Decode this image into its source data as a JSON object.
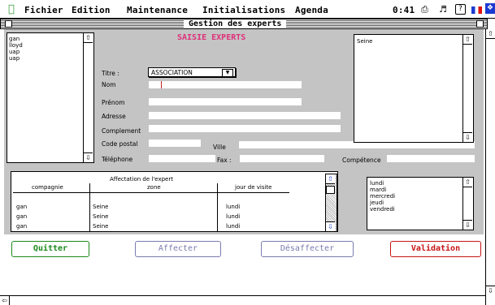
{
  "menubar": {
    "items": [
      "Fichier",
      "Edition",
      "Maintenance",
      "Initialisations",
      "Agenda"
    ],
    "clock": "0:41"
  },
  "window": {
    "title": "Gestion des experts"
  },
  "form": {
    "heading": "SAISIE EXPERTS",
    "titre_label": "Titre :",
    "titre_value": "ASSOCIATION",
    "nom_label": "Nom",
    "prenom_label": "Prénom",
    "adresse_label": "Adresse",
    "complement_label": "Complement",
    "code_postal_label": "Code postal",
    "ville_label": "Ville",
    "telephone_label": "Téléphone",
    "fax_label": "Fax :",
    "competence_label": "Compétence"
  },
  "experts_list": [
    "gan",
    "lloyd",
    "uap",
    "uap"
  ],
  "zone_list": [
    "Seine"
  ],
  "affectation": {
    "title": "Affectation de l'expert",
    "columns": [
      "compagnie",
      "zone",
      "jour de visite"
    ],
    "rows": [
      [
        "gan",
        "Seine",
        "lundi"
      ],
      [
        "gan",
        "Seine",
        "lundi"
      ],
      [
        "gan",
        "Seine",
        "lundi"
      ]
    ]
  },
  "days_list": [
    "lundi",
    "mardi",
    "mercredi",
    "jeudi",
    "vendredi"
  ],
  "buttons": {
    "quitter": "Quitter",
    "affecter": "Affecter",
    "desaffecter": "Désaffecter",
    "validation": "Validation"
  },
  "colors": {
    "heading": "#e0307a",
    "quitter": "#1a8a1a",
    "affecter": "#7a7ab0",
    "desaffecter": "#7a7ab0",
    "validation": "#c81414",
    "panel": "#c4c4c4"
  }
}
